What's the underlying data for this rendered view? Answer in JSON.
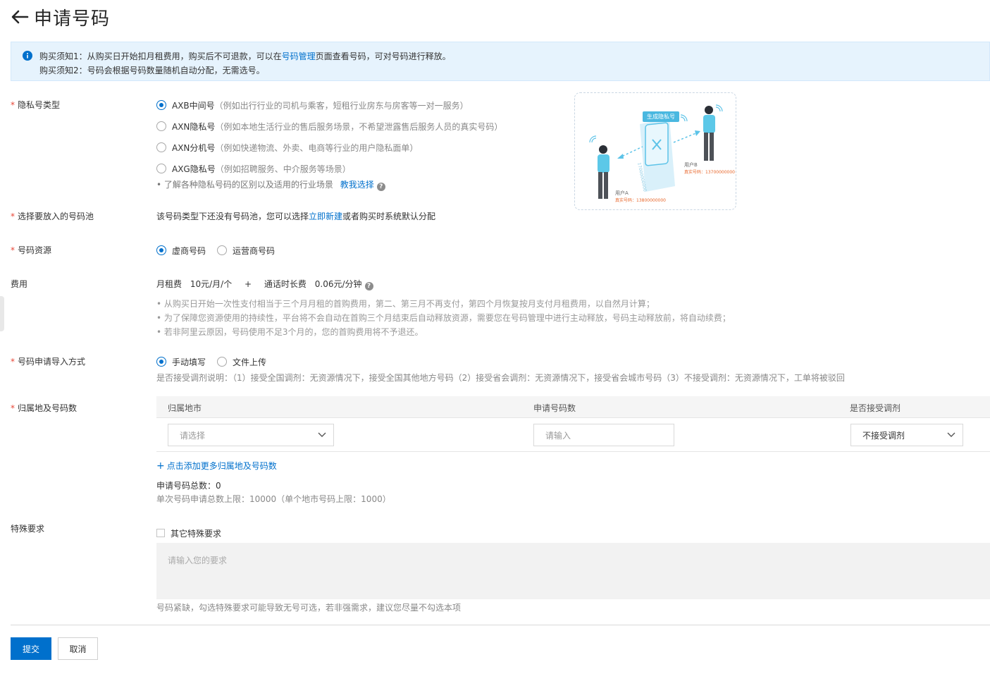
{
  "header": {
    "title": "申请号码"
  },
  "notice": {
    "line1_pre": "购买须知1：从购买日开始扣月租费用，购买后不可退款，可以在",
    "line1_link": "号码管理",
    "line1_post": "页面查看号码，可对号码进行释放。",
    "line2": "购买须知2：号码会根据号码数量随机自动分配，无需选号。"
  },
  "privacy_type": {
    "label": "隐私号类型",
    "options": [
      {
        "name": "AXB中间号",
        "desc": "（例如出行行业的司机与乘客，短租行业房东与房客等一对一服务）",
        "selected": true
      },
      {
        "name": "AXN隐私号",
        "desc": "（例如本地生活行业的售后服务场景，不希望泄露售后服务人员的真实号码）",
        "selected": false
      },
      {
        "name": "AXN分机号",
        "desc": "（例如快递物流、外卖、电商等行业的用户隐私面单）",
        "selected": false
      },
      {
        "name": "AXG隐私号",
        "desc": "（例如招聘服务、中介服务等场景）",
        "selected": false
      }
    ],
    "tip": "• 了解各种隐私号码的区别以及适用的行业场景",
    "tip_link": "教我选择"
  },
  "illustration": {
    "badge": "生成隐私号",
    "user_a": "用户A",
    "user_a_num": "真实号码：13800000000",
    "user_b": "用户B",
    "user_b_num": "真实号码：13700000000",
    "mid_num": "17000000000"
  },
  "pool": {
    "label": "选择要放入的号码池",
    "text_pre": "该号码类型下还没有号码池，您可以选择",
    "link": "立即新建",
    "text_post": "或者购买时系统默认分配"
  },
  "resource": {
    "label": "号码资源",
    "options": [
      {
        "name": "虚商号码",
        "selected": true
      },
      {
        "name": "运营商号码",
        "selected": false
      }
    ]
  },
  "fee": {
    "label": "费用",
    "monthly_label": "月租费",
    "monthly_value": "10元/月/个",
    "plus": "+",
    "call_label": "通话时长费",
    "call_value": "0.06元/分钟",
    "notes": [
      "• 从购买日开始一次性支付相当于三个月月租的首购费用，第二、第三月不再支付，第四个月恢复按月支付月租费用，以自然月计算；",
      "• 为了保障您资源使用的持续性，平台将不会自动在首购三个月结束后自动释放资源，需要您在号码管理中进行主动释放，号码主动释放前，将自动续费；",
      "• 若非阿里云原因，号码使用不足3个月的，您的首购费用将不予退还。"
    ]
  },
  "import_method": {
    "label": "号码申请导入方式",
    "options": [
      {
        "name": "手动填写",
        "selected": true
      },
      {
        "name": "文件上传",
        "selected": false
      }
    ],
    "desc": "是否接受调剂说明：（1）接受全国调剂：无资源情况下，接受全国其他地方号码（2）接受省会调剂：无资源情况下，接受省会城市号码（3）不接受调剂：无资源情况下，工单将被驳回"
  },
  "location": {
    "label": "归属地及号码数",
    "columns": [
      "归属地市",
      "申请号码数",
      "是否接受调剂"
    ],
    "city_placeholder": "请选择",
    "count_placeholder": "请输入",
    "adjust_value": "不接受调剂",
    "add_more": "点击添加更多归属地及号码数",
    "total_label": "申请号码总数：",
    "total_value": "0",
    "limit_text": "单次号码申请总数上限：10000（单个地市号码上限：1000）"
  },
  "special": {
    "label": "特殊要求",
    "checkbox_label": "其它特殊要求",
    "placeholder": "请输入您的要求",
    "hint": "号码紧缺，勾选特殊要求可能导致无号可选，若非强需求，建议您尽量不勾选本项"
  },
  "buttons": {
    "submit": "提交",
    "cancel": "取消"
  },
  "colors": {
    "primary": "#0070cc",
    "required": "#e84738",
    "notice_bg": "#e6f3fd"
  }
}
